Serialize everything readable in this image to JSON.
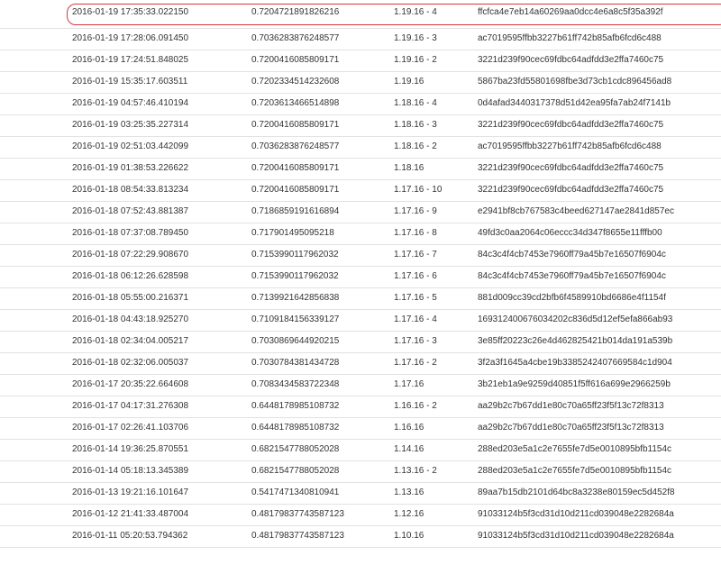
{
  "highlight_color": "#d9363e",
  "rows": [
    {
      "date": "2016-01-19 17:35:33.022150",
      "score": "0.7204721891826216",
      "version": "1.19.16 - 4",
      "hash": "ffcfca4e7eb14a60269aa0dcc4e6a8c5f35a392f"
    },
    {
      "date": "2016-01-19 17:28:06.091450",
      "score": "0.7036283876248577",
      "version": "1.19.16 - 3",
      "hash": "ac7019595ffbb3227b61ff742b85afb6fcd6c488"
    },
    {
      "date": "2016-01-19 17:24:51.848025",
      "score": "0.7200416085809171",
      "version": "1.19.16 - 2",
      "hash": "3221d239f90cec69fdbc64adfdd3e2ffa7460c75"
    },
    {
      "date": "2016-01-19 15:35:17.603511",
      "score": "0.7202334514232608",
      "version": "1.19.16",
      "hash": "5867ba23fd55801698fbe3d73cb1cdc896456ad8"
    },
    {
      "date": "2016-01-19 04:57:46.410194",
      "score": "0.7203613466514898",
      "version": "1.18.16 - 4",
      "hash": "0d4afad3440317378d51d42ea95fa7ab24f7141b"
    },
    {
      "date": "2016-01-19 03:25:35.227314",
      "score": "0.7200416085809171",
      "version": "1.18.16 - 3",
      "hash": "3221d239f90cec69fdbc64adfdd3e2ffa7460c75"
    },
    {
      "date": "2016-01-19 02:51:03.442099",
      "score": "0.7036283876248577",
      "version": "1.18.16 - 2",
      "hash": "ac7019595ffbb3227b61ff742b85afb6fcd6c488"
    },
    {
      "date": "2016-01-19 01:38:53.226622",
      "score": "0.7200416085809171",
      "version": "1.18.16",
      "hash": "3221d239f90cec69fdbc64adfdd3e2ffa7460c75"
    },
    {
      "date": "2016-01-18 08:54:33.813234",
      "score": "0.7200416085809171",
      "version": "1.17.16 - 10",
      "hash": "3221d239f90cec69fdbc64adfdd3e2ffa7460c75"
    },
    {
      "date": "2016-01-18 07:52:43.881387",
      "score": "0.7186859191616894",
      "version": "1.17.16 - 9",
      "hash": "e2941bf8cb767583c4beed627147ae2841d857ec"
    },
    {
      "date": "2016-01-18 07:37:08.789450",
      "score": "0.717901495095218",
      "version": "1.17.16 - 8",
      "hash": "49fd3c0aa2064c06eccc34d347f8655e11fffb00"
    },
    {
      "date": "2016-01-18 07:22:29.908670",
      "score": "0.7153990117962032",
      "version": "1.17.16 - 7",
      "hash": "84c3c4f4cb7453e7960ff79a45b7e16507f6904c"
    },
    {
      "date": "2016-01-18 06:12:26.628598",
      "score": "0.7153990117962032",
      "version": "1.17.16 - 6",
      "hash": "84c3c4f4cb7453e7960ff79a45b7e16507f6904c"
    },
    {
      "date": "2016-01-18 05:55:00.216371",
      "score": "0.7139921642856838",
      "version": "1.17.16 - 5",
      "hash": "881d009cc39cd2bfb6f4589910bd6686e4f1154f"
    },
    {
      "date": "2016-01-18 04:43:18.925270",
      "score": "0.7109184156339127",
      "version": "1.17.16 - 4",
      "hash": "169312400676034202c836d5d12ef5efa866ab93"
    },
    {
      "date": "2016-01-18 02:34:04.005217",
      "score": "0.7030869644920215",
      "version": "1.17.16 - 3",
      "hash": "3e85ff20223c26e4d462825421b014da191a539b"
    },
    {
      "date": "2016-01-18 02:32:06.005037",
      "score": "0.7030784381434728",
      "version": "1.17.16 - 2",
      "hash": "3f2a3f1645a4cbe19b3385242407669584c1d904"
    },
    {
      "date": "2016-01-17 20:35:22.664608",
      "score": "0.7083434583722348",
      "version": "1.17.16",
      "hash": "3b21eb1a9e9259d40851f5ff616a699e2966259b"
    },
    {
      "date": "2016-01-17 04:17:31.276308",
      "score": "0.6448178985108732",
      "version": "1.16.16 - 2",
      "hash": "aa29b2c7b67dd1e80c70a65ff23f5f13c72f8313"
    },
    {
      "date": "2016-01-17 02:26:41.103706",
      "score": "0.6448178985108732",
      "version": "1.16.16",
      "hash": "aa29b2c7b67dd1e80c70a65ff23f5f13c72f8313"
    },
    {
      "date": "2016-01-14 19:36:25.870551",
      "score": "0.6821547788052028",
      "version": "1.14.16",
      "hash": "288ed203e5a1c2e7655fe7d5e0010895bfb1154c"
    },
    {
      "date": "2016-01-14 05:18:13.345389",
      "score": "0.6821547788052028",
      "version": "1.13.16 - 2",
      "hash": "288ed203e5a1c2e7655fe7d5e0010895bfb1154c"
    },
    {
      "date": "2016-01-13 19:21:16.101647",
      "score": "0.5417471340810941",
      "version": "1.13.16",
      "hash": "89aa7b15db2101d64bc8a3238e80159ec5d452f8"
    },
    {
      "date": "2016-01-12 21:41:33.487004",
      "score": "0.48179837743587123",
      "version": "1.12.16",
      "hash": "91033124b5f3cd31d10d211cd039048e2282684a"
    },
    {
      "date": "2016-01-11 05:20:53.794362",
      "score": "0.48179837743587123",
      "version": "1.10.16",
      "hash": "91033124b5f3cd31d10d211cd039048e2282684a"
    }
  ]
}
